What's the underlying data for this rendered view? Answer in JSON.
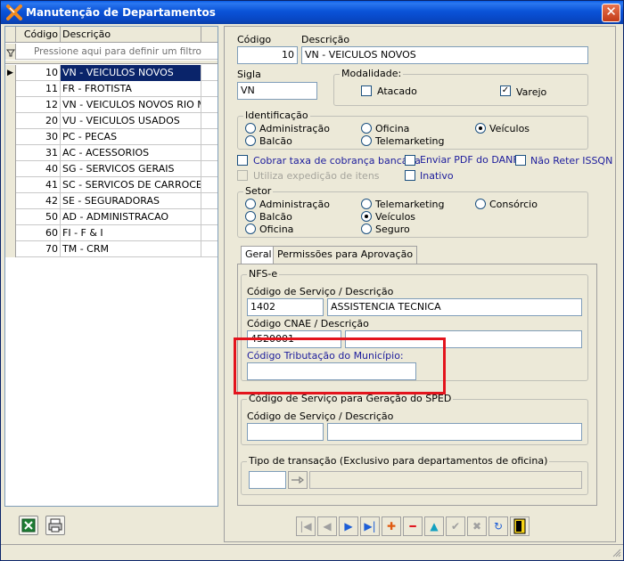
{
  "window": {
    "title": "Manutenção de Departamentos",
    "close_label": "✕"
  },
  "grid": {
    "col_code": "Código",
    "col_desc": "Descrição",
    "filter_placeholder": "Pressione aqui para definir um filtro",
    "rows": [
      {
        "code": "10",
        "desc": "VN - VEICULOS NOVOS",
        "selected": true
      },
      {
        "code": "11",
        "desc": "FR - FROTISTA"
      },
      {
        "code": "12",
        "desc": "VN - VEICULOS NOVOS RIO MAR"
      },
      {
        "code": "20",
        "desc": "VU - VEICULOS USADOS"
      },
      {
        "code": "30",
        "desc": "PC - PECAS"
      },
      {
        "code": "31",
        "desc": "AC - ACESSORIOS"
      },
      {
        "code": "40",
        "desc": "SG - SERVICOS GERAIS"
      },
      {
        "code": "41",
        "desc": "SC - SERVICOS DE CARROCERIA"
      },
      {
        "code": "42",
        "desc": "SE - SEGURADORAS"
      },
      {
        "code": "50",
        "desc": "AD - ADMINISTRACAO"
      },
      {
        "code": "60",
        "desc": "FI - F & I"
      },
      {
        "code": "70",
        "desc": "TM - CRM"
      }
    ]
  },
  "form": {
    "codigo_label": "Código",
    "codigo_value": "10",
    "descricao_label": "Descrição",
    "descricao_value": "VN - VEICULOS NOVOS",
    "sigla_label": "Sigla",
    "sigla_value": "VN",
    "modalidade": {
      "title": "Modalidade:",
      "atacado": "Atacado",
      "varejo": "Varejo"
    },
    "identificacao": {
      "title": "Identificação",
      "administracao": "Administração",
      "oficina": "Oficina",
      "veiculos": "Veículos",
      "balcao": "Balcão",
      "telemarketing": "Telemarketing"
    },
    "options": {
      "cobrar": "Cobrar taxa de cobrança bancária",
      "enviar_pdf": "Enviar PDF do DANFE",
      "nao_reter": "Não Reter ISSQN",
      "utiliza": "Utiliza expedição de itens",
      "inativo": "Inativo"
    },
    "setor": {
      "title": "Setor",
      "administracao": "Administração",
      "telemarketing": "Telemarketing",
      "consorcio": "Consórcio",
      "balcao": "Balcão",
      "veiculos": "Veículos",
      "oficina": "Oficina",
      "seguro": "Seguro"
    },
    "tabs": {
      "geral": "Geral",
      "permissoes": "Permissões para Aprovação"
    },
    "nfse": {
      "title": "NFS-e",
      "servico_label": "Código de Serviço / Descrição",
      "servico_code": "1402",
      "servico_desc": "ASSISTENCIA TECNICA",
      "cnae_label": "Código CNAE / Descrição",
      "cnae_code": "4520001",
      "cnae_desc": "",
      "tributacao_label": "Código Tributação do Município:",
      "tributacao_value": ""
    },
    "sped": {
      "title": "Código de Serviço para Geração do SPED",
      "servico_label": "Código de Serviço / Descrição",
      "code": "",
      "desc": ""
    },
    "transacao": {
      "title": "Tipo de transação (Exclusivo para departamentos de oficina)",
      "code": "",
      "desc": ""
    }
  },
  "colors": {
    "accent": "#0a246a",
    "highlight": "#e3141d"
  }
}
